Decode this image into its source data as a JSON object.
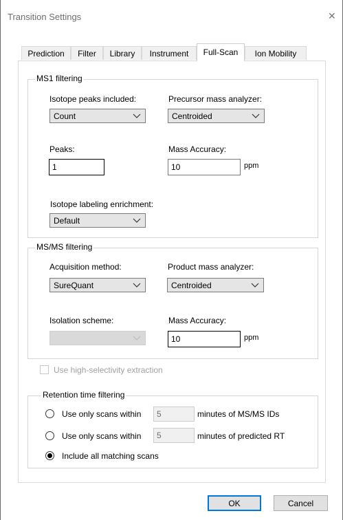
{
  "window": {
    "title": "Transition Settings",
    "close_glyph": "✕"
  },
  "tabs": [
    {
      "label": "Prediction"
    },
    {
      "label": "Filter"
    },
    {
      "label": "Library"
    },
    {
      "label": "Instrument"
    },
    {
      "label": "Full-Scan",
      "active": true
    },
    {
      "label": "Ion Mobility"
    }
  ],
  "ms1": {
    "legend": "MS1 filtering",
    "isotope_peaks_label": "Isotope peaks included:",
    "isotope_peaks_value": "Count",
    "precursor_analyzer_label": "Precursor mass analyzer:",
    "precursor_analyzer_value": "Centroided",
    "peaks_label": "Peaks:",
    "peaks_value": "1",
    "mass_accuracy_label": "Mass Accuracy:",
    "mass_accuracy_value": "10",
    "mass_accuracy_unit": "ppm",
    "enrichment_label": "Isotope labeling enrichment:",
    "enrichment_value": "Default"
  },
  "msms": {
    "legend": "MS/MS filtering",
    "acquisition_label": "Acquisition method:",
    "acquisition_value": "SureQuant",
    "product_analyzer_label": "Product mass analyzer:",
    "product_analyzer_value": "Centroided",
    "isolation_label": "Isolation scheme:",
    "isolation_value": "",
    "mass_accuracy_label": "Mass Accuracy:",
    "mass_accuracy_value": "10",
    "mass_accuracy_unit": "ppm"
  },
  "high_selectivity": {
    "label": "Use high-selectivity extraction",
    "checked": false,
    "enabled": false
  },
  "retention": {
    "legend": "Retention time filtering",
    "option1_prefix": "Use only scans within",
    "option1_value": "5",
    "option1_suffix": "minutes of MS/MS IDs",
    "option2_prefix": "Use only scans within",
    "option2_value": "5",
    "option2_suffix": "minutes of predicted RT",
    "option3_label": "Include all matching scans",
    "selected": 3
  },
  "buttons": {
    "ok": "OK",
    "cancel": "Cancel"
  },
  "colors": {
    "titlebar_text": "#6d6d6d",
    "disabled_text": "#a0a0a0",
    "default_button_border": "#0078d7"
  }
}
